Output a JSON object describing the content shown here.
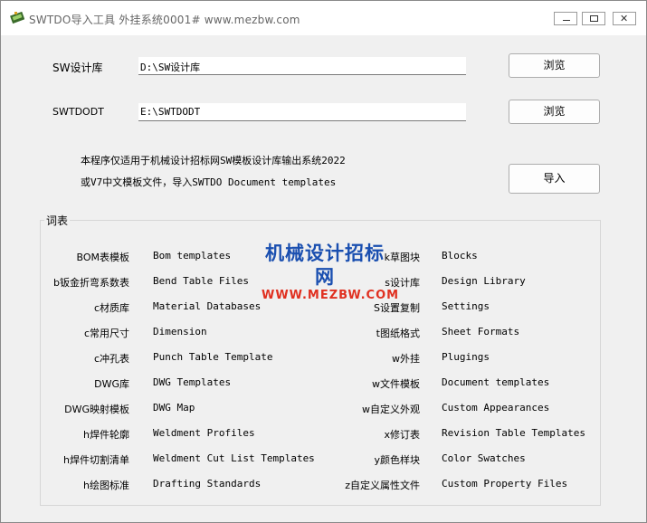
{
  "window": {
    "title": "SWTDO导入工具 外挂系统0001# www.mezbw.com"
  },
  "form": {
    "sw_lib_label": "SW设计库",
    "sw_lib_value": "D:\\SW设计库",
    "swtdodt_label": "SWTDODT",
    "swtdodt_value": "E:\\SWTDODT",
    "browse_label_1": "浏览",
    "browse_label_2": "浏览",
    "import_label": "导入"
  },
  "description": {
    "line1": "本程序仅适用于机械设计招标网SW模板设计库输出系统2022",
    "line2": "或V7中文模板文件，导入SWTDO Document templates"
  },
  "glossary": {
    "title": "词表",
    "left": [
      {
        "key": "BOM表模板",
        "value": "Bom templates"
      },
      {
        "key": "b钣金折弯系数表",
        "value": "Bend Table Files"
      },
      {
        "key": "c材质库",
        "value": "Material Databases"
      },
      {
        "key": "c常用尺寸",
        "value": "Dimension"
      },
      {
        "key": "c冲孔表",
        "value": "Punch Table Template"
      },
      {
        "key": "DWG库",
        "value": "DWG Templates"
      },
      {
        "key": "DWG映射模板",
        "value": "DWG Map"
      },
      {
        "key": "h焊件轮廓",
        "value": "Weldment Profiles"
      },
      {
        "key": "h焊件切割清单",
        "value": "Weldment Cut List Templates"
      },
      {
        "key": "h绘图标准",
        "value": "Drafting Standards"
      }
    ],
    "right": [
      {
        "key": "k草图块",
        "value": "Blocks"
      },
      {
        "key": "s设计库",
        "value": "Design Library"
      },
      {
        "key": "S设置复制",
        "value": "Settings"
      },
      {
        "key": "t图纸格式",
        "value": "Sheet Formats"
      },
      {
        "key": "w外挂",
        "value": "Plugings"
      },
      {
        "key": "w文件模板",
        "value": "Document templates"
      },
      {
        "key": "w自定义外观",
        "value": "Custom Appearances"
      },
      {
        "key": "x修订表",
        "value": "Revision Table Templates"
      },
      {
        "key": "y颜色样块",
        "value": "Color Swatches"
      },
      {
        "key": "z自定义属性文件",
        "value": "Custom Property Files"
      }
    ]
  },
  "watermark": {
    "line1": "机械设计招标网",
    "line2": "WWW.MEZBW.COM"
  }
}
